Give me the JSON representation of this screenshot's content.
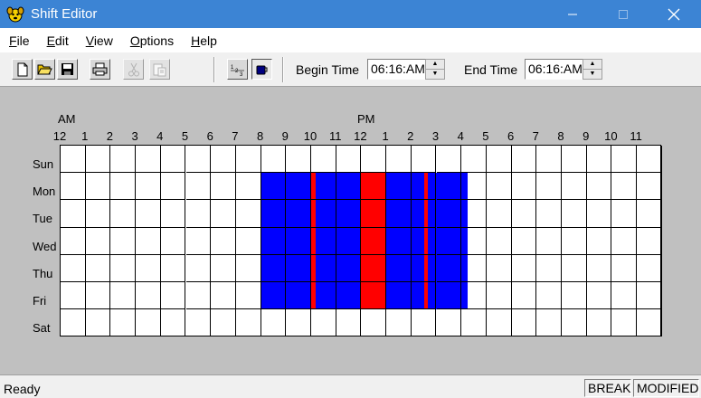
{
  "window": {
    "title": "Shift Editor"
  },
  "menu": [
    {
      "label": "File",
      "mnemonic": "F"
    },
    {
      "label": "Edit",
      "mnemonic": "E"
    },
    {
      "label": "View",
      "mnemonic": "V"
    },
    {
      "label": "Options",
      "mnemonic": "O"
    },
    {
      "label": "Help",
      "mnemonic": "H"
    }
  ],
  "toolbar": {
    "buttons": [
      {
        "icon": "new-document-icon",
        "enabled": true
      },
      {
        "icon": "open-folder-icon",
        "enabled": true
      },
      {
        "icon": "save-disk-icon",
        "enabled": true
      },
      {
        "icon": "print-icon",
        "enabled": true
      },
      {
        "icon": "cut-scissors-icon",
        "enabled": false
      },
      {
        "icon": "paste-icon",
        "enabled": false
      },
      {
        "icon": "sort-order-icon",
        "enabled": true
      },
      {
        "icon": "break-cup-icon",
        "enabled": true
      }
    ],
    "begin_time_label": "Begin Time",
    "begin_time_value": "06:16:AM",
    "end_time_label": "End Time",
    "end_time_value": "06:16:AM"
  },
  "schedule": {
    "am_label": "AM",
    "pm_label": "PM",
    "hours": [
      "12",
      "1",
      "2",
      "3",
      "4",
      "5",
      "6",
      "7",
      "8",
      "9",
      "10",
      "11",
      "12",
      "1",
      "2",
      "3",
      "4",
      "5",
      "6",
      "7",
      "8",
      "9",
      "10",
      "11"
    ],
    "days": [
      "Sun",
      "Mon",
      "Tue",
      "Wed",
      "Thu",
      "Fri",
      "Sat"
    ],
    "colors": {
      "shift": "#0000ff",
      "break": "#ff0000",
      "empty": "#ffffff"
    },
    "shift_days": [
      "Mon",
      "Tue",
      "Wed",
      "Thu",
      "Fri"
    ],
    "shift_blocks": [
      {
        "type": "shift",
        "start_hour": 8.0,
        "end_hour": 10.0
      },
      {
        "type": "break",
        "start_hour": 10.0,
        "end_hour": 10.17
      },
      {
        "type": "shift",
        "start_hour": 10.17,
        "end_hour": 12.0
      },
      {
        "type": "break",
        "start_hour": 12.0,
        "end_hour": 13.0
      },
      {
        "type": "shift",
        "start_hour": 13.0,
        "end_hour": 14.5
      },
      {
        "type": "break",
        "start_hour": 14.5,
        "end_hour": 14.67
      },
      {
        "type": "shift",
        "start_hour": 14.67,
        "end_hour": 16.25
      }
    ]
  },
  "status": {
    "text": "Ready",
    "panels": [
      "BREAK",
      "MODIFIED"
    ]
  }
}
